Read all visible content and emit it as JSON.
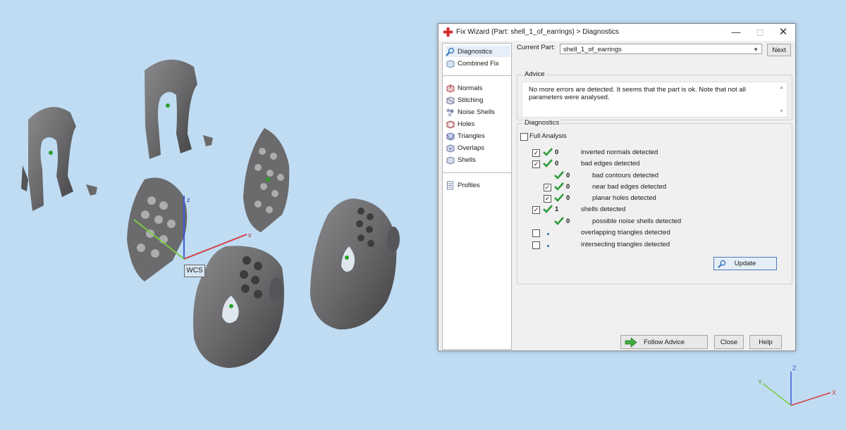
{
  "scene": {
    "wcs_label": "WCS",
    "axis_x": "x",
    "axis_z": "z"
  },
  "triad": {
    "z": "Z",
    "x": "X",
    "y": "Y"
  },
  "dialog": {
    "title": "Fix Wizard (Part: shell_1_of_earrings) > Diagnostics",
    "sidebar": {
      "items": [
        {
          "label": "Diagnostics"
        },
        {
          "label": "Combined Fix"
        },
        {
          "label": "Normals"
        },
        {
          "label": "Stitching"
        },
        {
          "label": "Noise Shells"
        },
        {
          "label": "Holes"
        },
        {
          "label": "Triangles"
        },
        {
          "label": "Overlaps"
        },
        {
          "label": "Shells"
        },
        {
          "label": "Profiles"
        }
      ]
    },
    "current_part_label": "Current Part:",
    "current_part_value": "shell_1_of_earrings",
    "next_label": "Next",
    "advice": {
      "title": "Advice",
      "text": "No more errors are detected. It seems that the part is ok. Note that not all parameters were analysed."
    },
    "diagnostics": {
      "title": "Diagnostics",
      "full_analysis_label": "Full Analysis",
      "rows": [
        {
          "count": "0",
          "label": "inverted normals detected"
        },
        {
          "count": "0",
          "label": "bad edges detected"
        },
        {
          "count": "0",
          "label": "bad contours detected"
        },
        {
          "count": "0",
          "label": "near bad edges detected"
        },
        {
          "count": "0",
          "label": "planar holes detected"
        },
        {
          "count": "1",
          "label": "shells detected"
        },
        {
          "count": "0",
          "label": "possible noise shells detected"
        },
        {
          "count": "",
          "label": "overlapping triangles detected"
        },
        {
          "count": "",
          "label": "intersecting triangles detected"
        }
      ]
    },
    "update_label": "Update",
    "follow_advice_label": "Follow Advice",
    "close_label": "Close",
    "help_label": "Help",
    "colors": {
      "check_green": "#2e9b3a",
      "accent_blue": "#4a79b8",
      "title_red": "#d42b2b"
    }
  }
}
